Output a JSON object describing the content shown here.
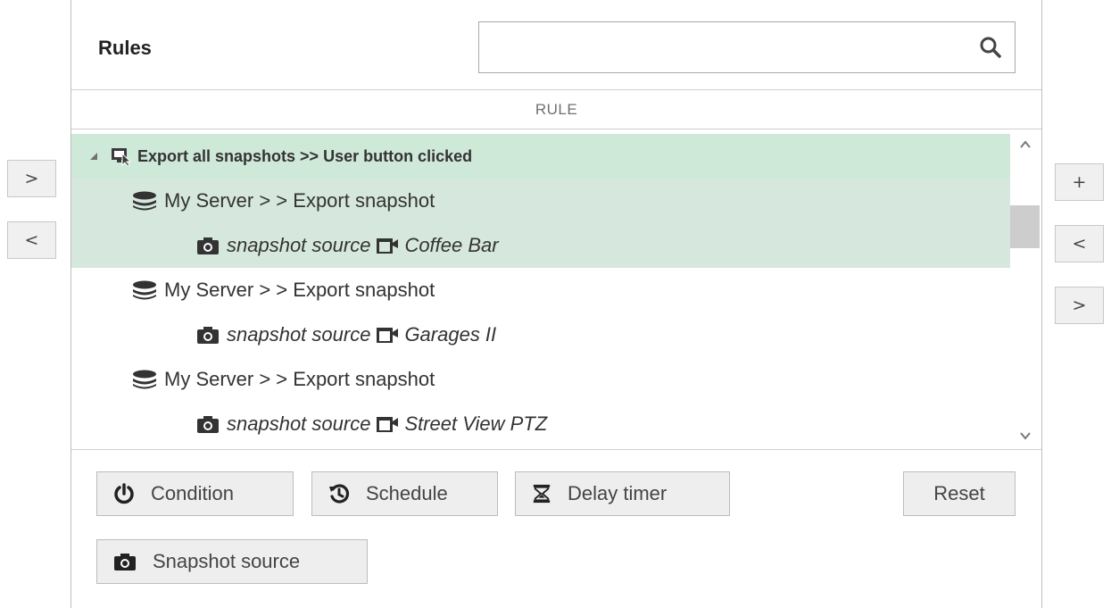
{
  "left_nav": {
    "forward_label": ">",
    "back_label": "<"
  },
  "right_nav": {
    "add_label": "+",
    "back_label": "<",
    "forward_label": ">"
  },
  "header": {
    "title": "Rules",
    "search": {
      "value": "",
      "placeholder": ""
    }
  },
  "table": {
    "column_header": "RULE"
  },
  "tree": {
    "root": {
      "label": "Export all snapshots >> User button clicked",
      "icon": "user-button-click-icon",
      "expanded": true
    },
    "actions": [
      {
        "label": "My Server > > Export snapshot",
        "icon": "server-stack-icon",
        "child": {
          "prefix": "snapshot source",
          "camera": "Coffee Bar",
          "icon": "camera-icon",
          "camera_icon": "video-camera-icon"
        }
      },
      {
        "label": "My Server > > Export snapshot",
        "icon": "server-stack-icon",
        "child": {
          "prefix": "snapshot source",
          "camera": "Garages II",
          "icon": "camera-icon",
          "camera_icon": "video-camera-icon"
        }
      },
      {
        "label": "My Server > > Export snapshot",
        "icon": "server-stack-icon",
        "child": {
          "prefix": "snapshot source",
          "camera": "Street View PTZ",
          "icon": "camera-icon",
          "camera_icon": "video-camera-icon"
        }
      }
    ],
    "scroll_arrows": {
      "up": "^",
      "down": "v"
    }
  },
  "toolbar": {
    "condition_label": "Condition",
    "schedule_label": "Schedule",
    "delay_timer_label": "Delay timer",
    "reset_label": "Reset",
    "snapshot_source_label": "Snapshot source"
  },
  "colors": {
    "selection_root": "#cfe9d9",
    "selection_children": "#d6e8dd",
    "button_bg": "#eeeeee"
  }
}
